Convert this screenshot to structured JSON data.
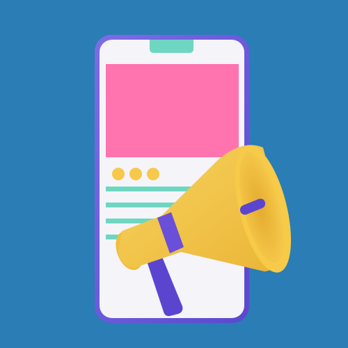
{
  "illustration": {
    "subject": "phone-with-megaphone",
    "icons": [
      "smartphone-icon",
      "megaphone-icon"
    ],
    "colors": {
      "background": "#2a7db5",
      "phone_frame": "#6a5ad8",
      "phone_screen": "#f3f3f8",
      "notch": "#6fd6c2",
      "banner": "#ff74ae",
      "dots": "#f7c84a",
      "text_lines": "#6fd6c2",
      "megaphone": "#f6c648",
      "megaphone_band": "#6a4fd8"
    },
    "indicator_dots": 3,
    "text_line_count": 4
  }
}
